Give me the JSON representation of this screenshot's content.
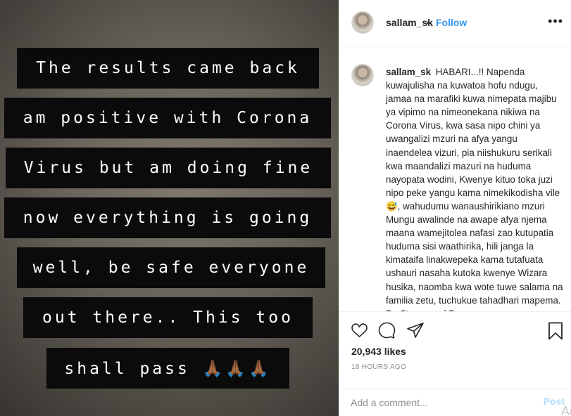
{
  "post": {
    "caption_lines": [
      "The results came back",
      "am positive with Corona",
      "Virus but am doing fine",
      "now everything is going",
      "well, be safe everyone",
      "out there.. This too",
      "shall pass 🙏🏾🙏🏾🙏🏾"
    ]
  },
  "header": {
    "username": "sallam_sk",
    "separator": "•",
    "follow_label": "Follow",
    "more_icon": "more-options-icon"
  },
  "comment": {
    "username": "sallam_sk",
    "text": "HABARI...!! Napenda kuwajulisha na kuwatoa hofu ndugu, jamaa na marafiki kuwa nimepata majibu ya vipimo na nimeonekana nikiwa na Corona Virus, kwa sasa nipo chini ya uwangalizi mzuri na afya yangu inaendelea vizuri, pia niishukuru serikali kwa maandalizi mazuri na huduma nayopata wodini, Kwenye kituo toka juzi nipo peke yangu kama nimekikodisha vile 😅, wahudumu wanaushirikiano mzuri Mungu awalinde na awape afya njema maana wamejitolea nafasi zao kutupatia huduma sisi waathirika, hili janga la kimataifa linakwepeka kama tutafuata ushauri nasaha kutoka kwenye Wizara husika, naomba kwa wote tuwe salama na familia zetu, tuchukue tahadhari mapema. Be Strong and Be"
  },
  "actions": {
    "likes": "20,943 likes",
    "timestamp": "18 HOURS AGO",
    "icons": [
      "heart-icon",
      "comment-icon",
      "share-icon",
      "bookmark-icon"
    ]
  },
  "add_comment": {
    "placeholder": "Add a comment...",
    "post_label": "Post"
  },
  "overlay": {
    "text": "Ac"
  },
  "colors": {
    "link": "#3897f0",
    "post_disabled": "#b2dffc",
    "muted": "#8e8e8e",
    "caption_bg": "#0b0b0b"
  }
}
